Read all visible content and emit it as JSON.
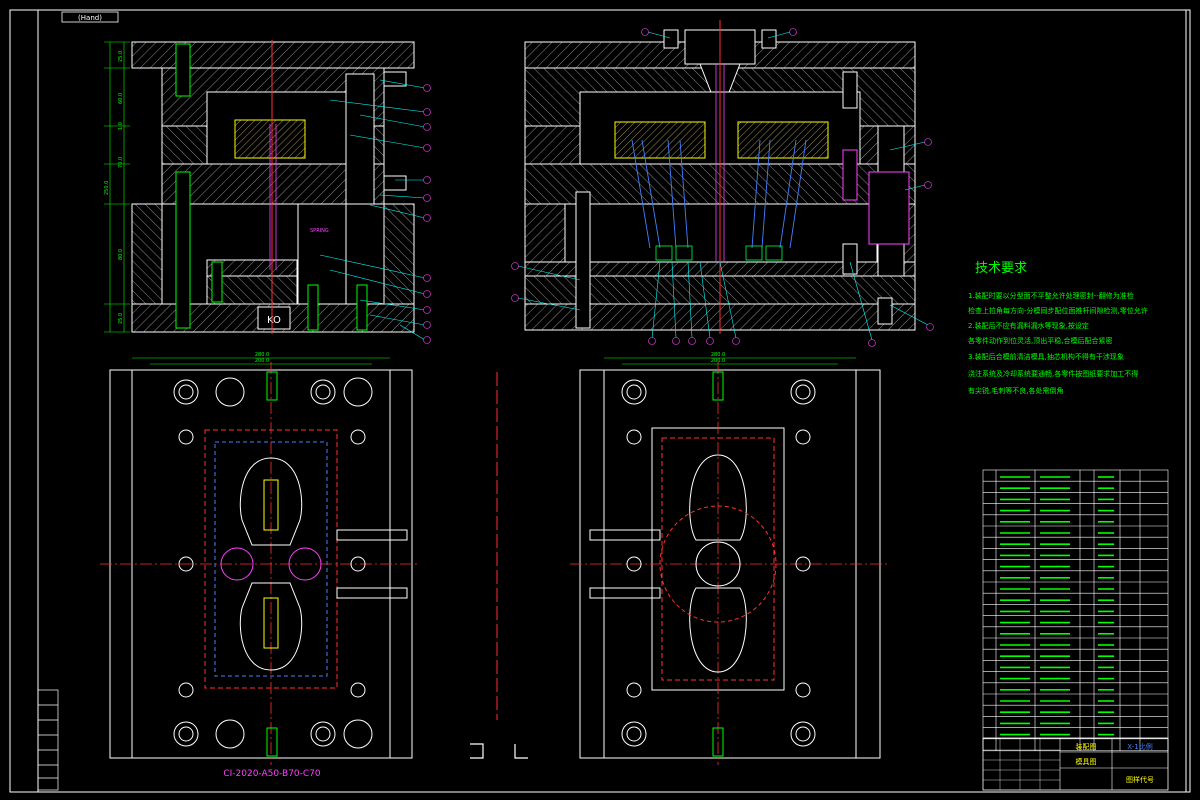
{
  "drawing": {
    "tag_label": "(Hand)",
    "base_label": "CI-2020-A50-B70-C70",
    "plate_label": "KO",
    "spring_label": "SPRING",
    "tech_title": "技术要求",
    "tech_lines": [
      "1.装配时要以分型面不平整允许处理密封--翻修为准检",
      "检查上拉角每方向-分模同步配位面推杆间隙检测,零位允许",
      "2.装配后不应有漏料漏水等现象,按设定",
      "各零件动作到位灵活,顶出平稳,合模后配合紧密",
      "3.装配后合模前清洁模具,抽芯机构不得有干涉现象",
      "浇注系统及冷却系统要通畅,各零件按图纸要求加工不得",
      "有尖锐,毛刺等不良,各处需倒角"
    ],
    "dims": {
      "width_outer": "280.0",
      "width_inner": "200.0",
      "height_total": "250.0",
      "heights_left": [
        "25.0",
        "60.0",
        "1.0",
        "70.0",
        "80.0",
        "25.0"
      ]
    },
    "balloons_count_note": ""
  },
  "title_block": {
    "cells": [
      "装配图",
      "X-1比例",
      "模具图",
      "图样代号"
    ]
  },
  "colors": {
    "background": "#000000",
    "outline": "#ffffff",
    "center": "#ff3030",
    "green": "#00ff40",
    "magenta": "#ff40ff",
    "cyan": "#00ffff",
    "yellow": "#ffff00",
    "blue": "#4080ff"
  }
}
